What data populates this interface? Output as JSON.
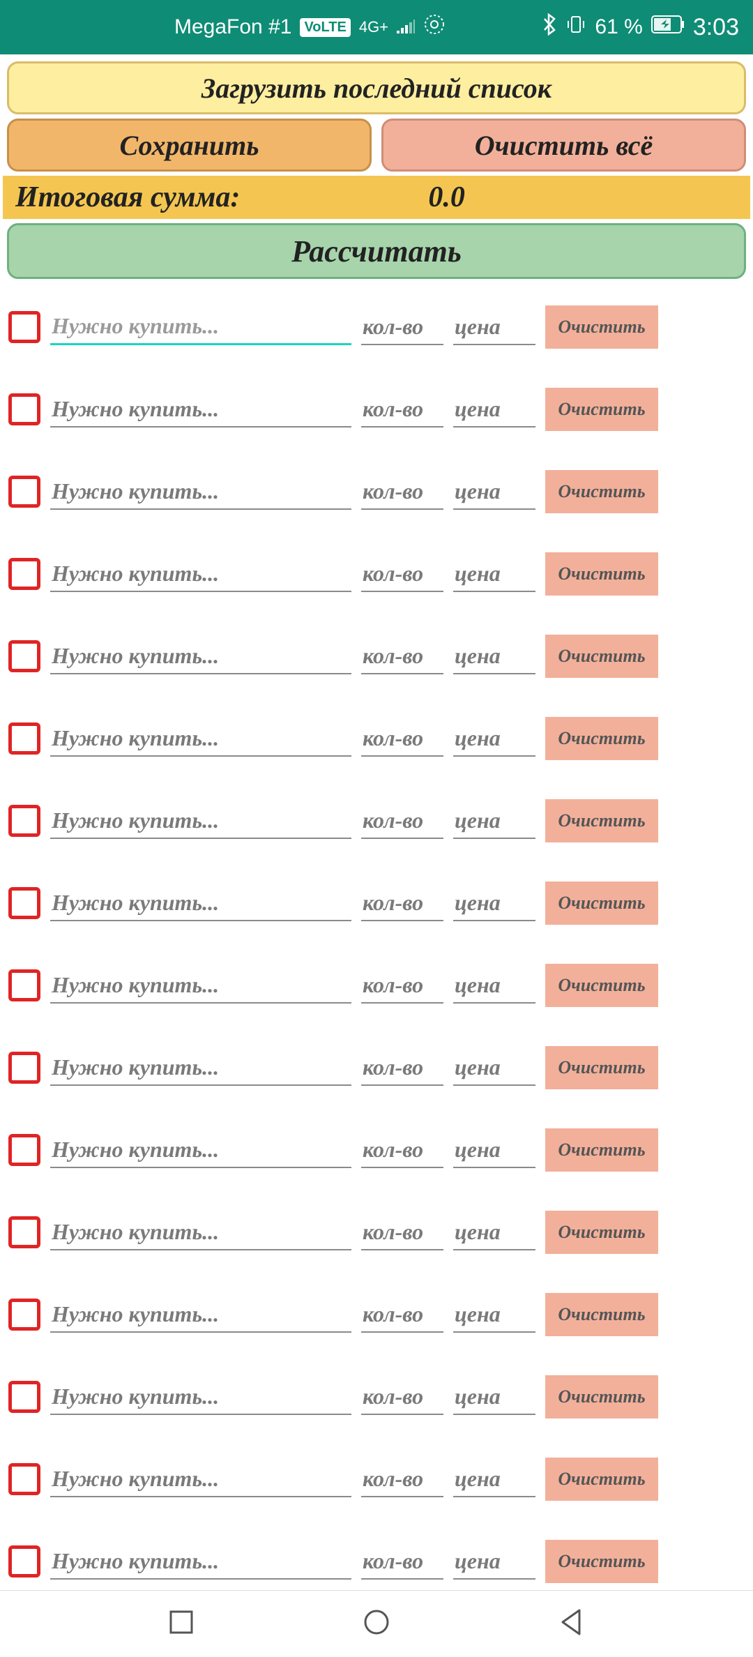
{
  "status": {
    "carrier": "MegaFon #1",
    "volte": "VoLTE",
    "net": "4G+",
    "battery": "61 %",
    "time": "3:03"
  },
  "buttons": {
    "load": "Загрузить последний список",
    "save": "Сохранить",
    "clear_all": "Очистить всё",
    "calculate": "Рассчитать"
  },
  "total": {
    "label": "Итоговая сумма:",
    "value": "0.0"
  },
  "row": {
    "name_placeholder": "Нужно купить...",
    "qty_placeholder": "кол-во",
    "price_placeholder": "цена",
    "clear_label": "Очистить"
  },
  "row_count": 16
}
